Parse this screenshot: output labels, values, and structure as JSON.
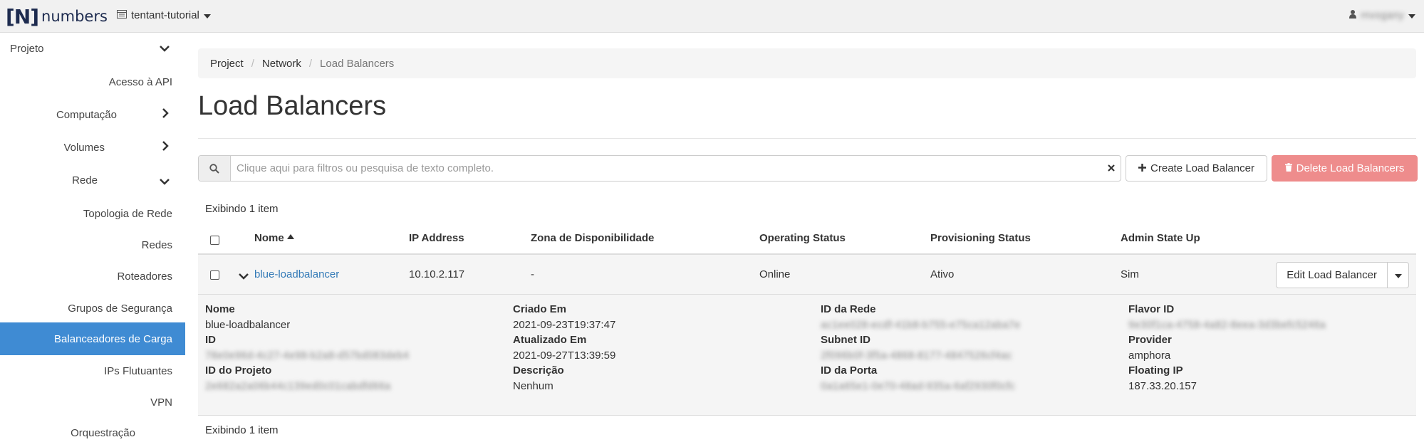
{
  "topbar": {
    "logo_bracket": "[N]",
    "logo_text": "numbers",
    "project": "tentant-tutorial",
    "user": "mvogany"
  },
  "sidebar": {
    "items": [
      {
        "label": "Projeto",
        "chevron": "down"
      },
      {
        "label": "Acesso à API"
      },
      {
        "label": "Computação",
        "chevron": "right"
      },
      {
        "label": "Volumes",
        "chevron": "right"
      },
      {
        "label": "Rede",
        "chevron": "down"
      },
      {
        "label": "Topologia de Rede"
      },
      {
        "label": "Redes"
      },
      {
        "label": "Roteadores"
      },
      {
        "label": "Grupos de Segurança"
      },
      {
        "label": "Balanceadores de Carga",
        "active": true
      },
      {
        "label": "IPs Flutuantes"
      },
      {
        "label": "VPN"
      },
      {
        "label": "Orquestração"
      }
    ]
  },
  "breadcrumb": [
    "Project",
    "Network",
    "Load Balancers"
  ],
  "page_title": "Load Balancers",
  "search": {
    "placeholder": "Clique aqui para filtros ou pesquisa de texto completo."
  },
  "actions": {
    "create": "Create Load Balancer",
    "delete": "Delete Load Balancers"
  },
  "table": {
    "count_text": "Exibindo 1 item",
    "headers": [
      "Nome",
      "IP Address",
      "Zona de Disponibilidade",
      "Operating Status",
      "Provisioning Status",
      "Admin State Up"
    ],
    "row": {
      "name": "blue-loadbalancer",
      "ip": "10.10.2.117",
      "zone": "-",
      "operating": "Online",
      "provisioning": "Ativo",
      "admin": "Sim",
      "action": "Edit Load Balancer"
    },
    "detail": [
      [
        {
          "k": "Nome",
          "v": "blue-loadbalancer"
        },
        {
          "k": "ID",
          "v": "78e0e96d-4c27-4e98-b2a8-d57bd083deb4",
          "blur": true
        },
        {
          "k": "ID do Projeto",
          "v": "2e682a2a06b44c139ed0c01cabdfd66a",
          "blur": true
        }
      ],
      [
        {
          "k": "Criado Em",
          "v": "2021-09-23T19:37:47"
        },
        {
          "k": "Atualizado Em",
          "v": "2021-09-27T13:39:59"
        },
        {
          "k": "Descrição",
          "v": "Nenhum"
        }
      ],
      [
        {
          "k": "ID da Rede",
          "v": "ac1ee028-ecdf-41b8-b755-e75ca12aba7e",
          "blur": true
        },
        {
          "k": "Subnet ID",
          "v": "2f096b0f-3f5a-4868-8177-4847526cf4ac",
          "blur": true
        },
        {
          "k": "ID da Porta",
          "v": "0a1a65e1-0e70-48ad-935a-6af2930f0cfc",
          "blur": true
        }
      ],
      [
        {
          "k": "Flavor ID",
          "v": "9e30f1ca-4758-4a82-8eea-3d3befc5246a",
          "blur": true
        },
        {
          "k": "Provider",
          "v": "amphora"
        },
        {
          "k": "Floating IP",
          "v": "187.33.20.157"
        }
      ]
    ],
    "footer_count": "Exibindo 1 item"
  }
}
